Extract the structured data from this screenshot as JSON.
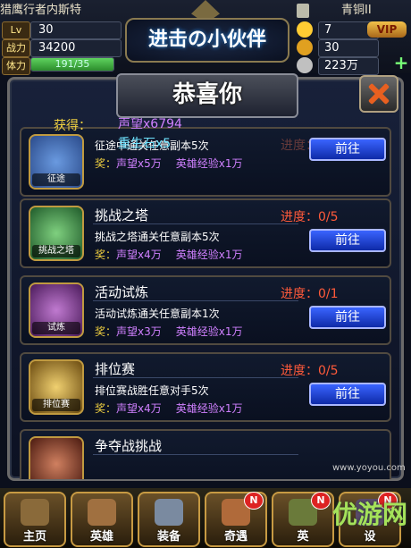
{
  "hud": {
    "player_name": "猎鹰行者内斯特",
    "level_label": "Lv",
    "level": "30",
    "power_label": "战力",
    "power": "34200",
    "stamina_label": "体力",
    "stamina": "191/35",
    "stamina_fraction": 1.0,
    "rank_name": "青铜II",
    "gems": "7",
    "vip_label": "VIP",
    "gold": "30",
    "coins": "223万",
    "game_title": "进击の小伙伴"
  },
  "popup": {
    "title": "恭喜你",
    "gain_label": "获得：",
    "gain_items": [
      "声望x6794",
      "重生石x5"
    ],
    "quests": [
      {
        "title": "征途",
        "icon_label": "征途",
        "progress": "进度：0/5",
        "desc": "征途中通关任意副本5次",
        "reward_label": "奖：",
        "reward_1": "声望x5万",
        "reward_2": "英雄经验x1万",
        "button": "前往",
        "icon_color": "#2a4a8a"
      },
      {
        "title": "挑战之塔",
        "icon_label": "挑战之塔",
        "progress": "进度：0/5",
        "desc": "挑战之塔通关任意副本5次",
        "reward_label": "奖：",
        "reward_1": "声望x4万",
        "reward_2": "英雄经验x1万",
        "button": "前往",
        "icon_color": "#2a6a3a"
      },
      {
        "title": "活动试炼",
        "icon_label": "试炼",
        "progress": "进度：0/1",
        "desc": "活动试炼通关任意副本1次",
        "reward_label": "奖：",
        "reward_1": "声望x3万",
        "reward_2": "英雄经验x1万",
        "button": "前往",
        "icon_color": "#5a2a6a"
      },
      {
        "title": "排位赛",
        "icon_label": "排位赛",
        "progress": "进度：0/5",
        "desc": "排位赛战胜任意对手5次",
        "reward_label": "奖：",
        "reward_1": "声望x4万",
        "reward_2": "英雄经验x1万",
        "button": "前往",
        "icon_color": "#7a5a1a"
      },
      {
        "title": "争夺战挑战",
        "icon_label": "",
        "progress": "",
        "desc": "",
        "reward_label": "",
        "reward_1": "",
        "reward_2": "",
        "button": "",
        "icon_color": "#6a3a2a"
      }
    ]
  },
  "nav": [
    {
      "label": "主页",
      "badge": ""
    },
    {
      "label": "英雄",
      "badge": ""
    },
    {
      "label": "装备",
      "badge": ""
    },
    {
      "label": "奇遇",
      "badge": "N"
    },
    {
      "label": "英",
      "badge": "N"
    },
    {
      "label": "设",
      "badge": "N"
    }
  ],
  "watermark": "优游网",
  "watermark_site": "www.yoyou.com"
}
